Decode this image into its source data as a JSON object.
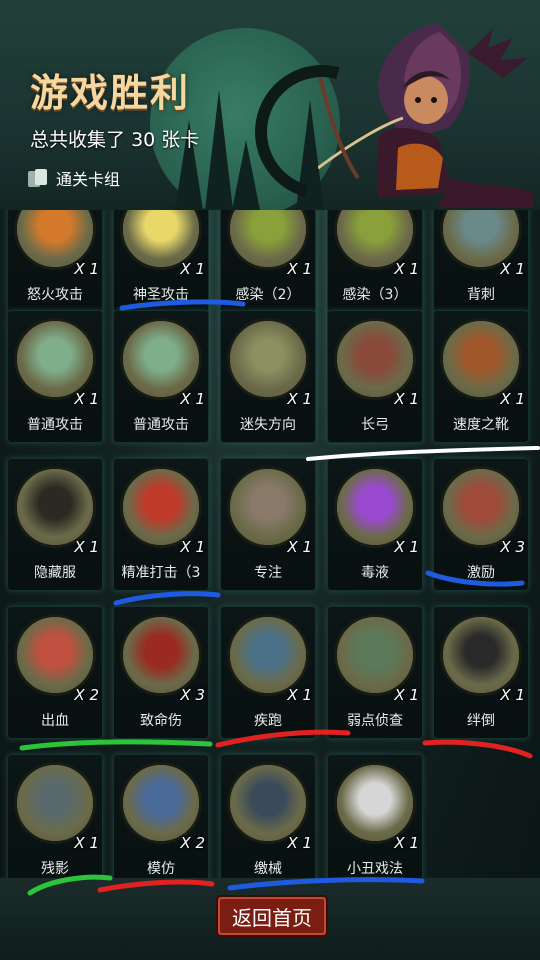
{
  "header": {
    "title": "游戏胜利",
    "summary_prefix": "总共收集了",
    "summary_count": "30",
    "summary_suffix": "张卡",
    "deck_link": "通关卡组"
  },
  "cards": [
    {
      "name": "怒火攻击",
      "count": "X 1",
      "icon": "fire-fist-icon",
      "color": "#d47a2a"
    },
    {
      "name": "神圣攻击",
      "count": "X 1",
      "icon": "holy-burst-icon",
      "color": "#e8d86a"
    },
    {
      "name": "感染（2）",
      "count": "X 1",
      "icon": "infection-icon",
      "color": "#8aa03a"
    },
    {
      "name": "感染（3）",
      "count": "X 1",
      "icon": "infection-icon",
      "color": "#8aa03a"
    },
    {
      "name": "背刺",
      "count": "X 1",
      "icon": "backstab-icon",
      "color": "#6a8a8a"
    },
    {
      "name": "普通攻击",
      "count": "X 1",
      "icon": "spear-icon",
      "color": "#7fae8a"
    },
    {
      "name": "普通攻击",
      "count": "X 1",
      "icon": "spear-icon",
      "color": "#7fae8a"
    },
    {
      "name": "迷失方向",
      "count": "X 1",
      "icon": "signpost-icon",
      "color": "#8a9060"
    },
    {
      "name": "长弓",
      "count": "X 1",
      "icon": "longbow-icon",
      "color": "#8a4a3a"
    },
    {
      "name": "速度之靴",
      "count": "X 1",
      "icon": "boot-icon",
      "color": "#a0582a"
    },
    {
      "name": "隐藏服",
      "count": "X 1",
      "icon": "hood-icon",
      "color": "#2a2a22"
    },
    {
      "name": "精准打击（3",
      "count": "X 1",
      "icon": "target-icon",
      "color": "#c03a2a"
    },
    {
      "name": "专注",
      "count": "X 1",
      "icon": "wizard-icon",
      "color": "#8a7a6a"
    },
    {
      "name": "毒液",
      "count": "X 1",
      "icon": "poison-icon",
      "color": "#9a4ad0"
    },
    {
      "name": "激励",
      "count": "X 3",
      "icon": "hammer-icon",
      "color": "#a04a3a"
    },
    {
      "name": "出血",
      "count": "X 2",
      "icon": "bleed-monster-icon",
      "color": "#c05040"
    },
    {
      "name": "致命伤",
      "count": "X 3",
      "icon": "blood-drip-icon",
      "color": "#9a2a22"
    },
    {
      "name": "疾跑",
      "count": "X 1",
      "icon": "runner-icon",
      "color": "#4a7088"
    },
    {
      "name": "弱点侦查",
      "count": "X 1",
      "icon": "wolf-icon",
      "color": "#5a7a5a"
    },
    {
      "name": "绊倒",
      "count": "X 1",
      "icon": "trip-boot-icon",
      "color": "#2a2a2a"
    },
    {
      "name": "残影",
      "count": "X 1",
      "icon": "shadow-clones-icon",
      "color": "#5a6a6a"
    },
    {
      "name": "模仿",
      "count": "X 2",
      "icon": "goblin-icon",
      "color": "#4a6a9a"
    },
    {
      "name": "缴械",
      "count": "X 1",
      "icon": "disarm-card-icon",
      "color": "#3a4a5a"
    },
    {
      "name": "小丑戏法",
      "count": "X 1",
      "icon": "clown-icon",
      "color": "#d6d6d6"
    }
  ],
  "footer": {
    "return_label": "返回首页"
  }
}
